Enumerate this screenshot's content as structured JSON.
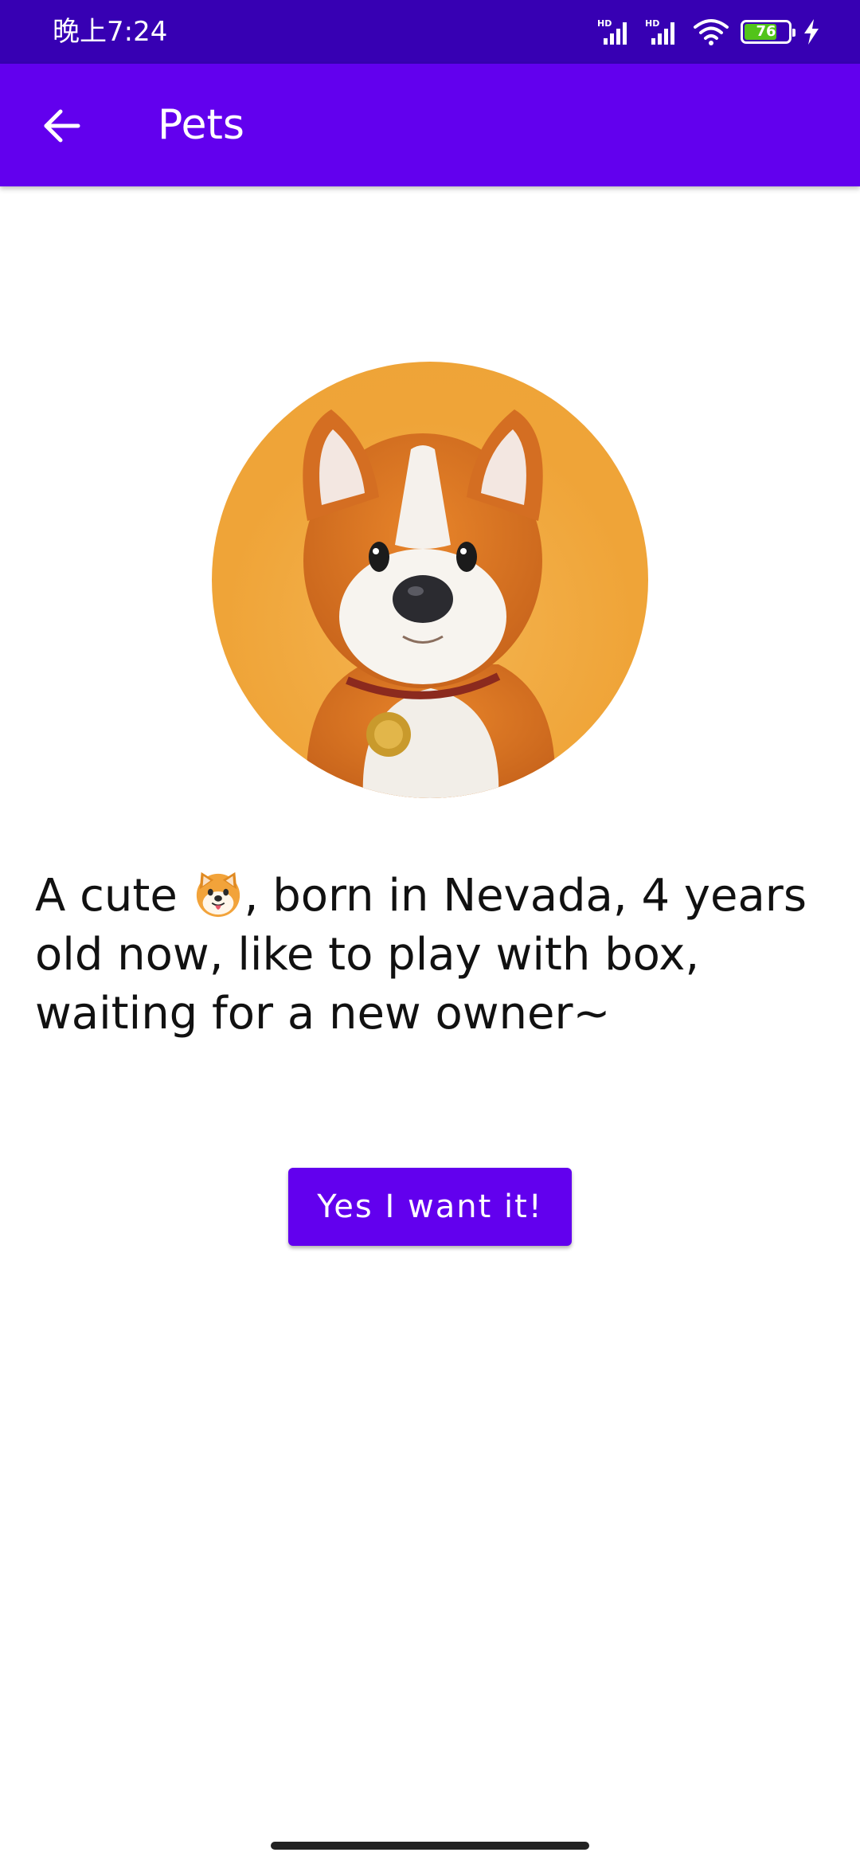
{
  "status_bar": {
    "time": "晚上7:24",
    "battery_level": "76",
    "battery_fraction": 0.76,
    "icons": [
      "hd-signal-icon",
      "hd-signal-icon",
      "wifi-icon",
      "battery-icon",
      "charging-icon"
    ]
  },
  "app_bar": {
    "title": "Pets",
    "back_icon": "arrow-back-icon"
  },
  "pet": {
    "image_icon": "dog-avatar",
    "description_before_emoji": "A cute ",
    "emoji": "dog-face-emoji",
    "description_after_emoji": ", born in Nevada, 4 years old now, like to play with box, waiting for a new owner~"
  },
  "actions": {
    "adopt_label": "Yes I want it!"
  },
  "colors": {
    "status_bar": "#3700b3",
    "primary": "#6200ee",
    "avatar_background": "#efa438"
  }
}
